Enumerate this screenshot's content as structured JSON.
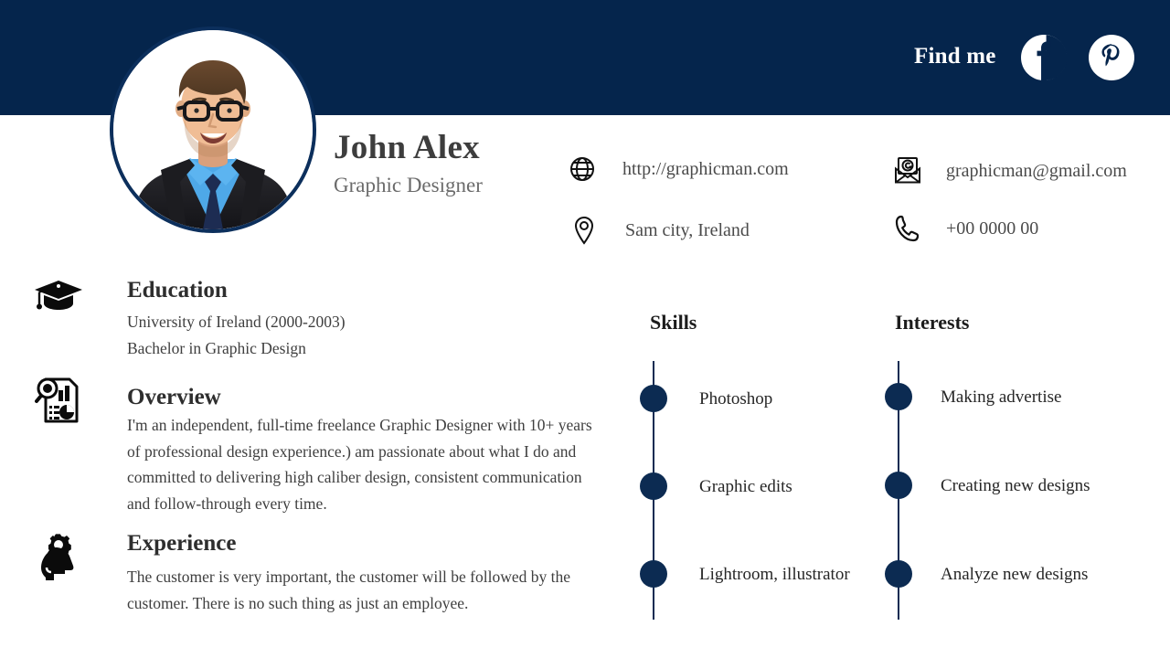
{
  "header": {
    "find_me_label": "Find me",
    "background_color": "#05254C",
    "social": [
      {
        "name": "facebook-icon",
        "label": "Facebook"
      },
      {
        "name": "pinterest-icon",
        "label": "Pinterest"
      }
    ]
  },
  "profile": {
    "name": "John Alex",
    "job_title": "Graphic Designer",
    "photo_alt": "Portrait of a smiling man with glasses wearing a dark suit, blue shirt and navy tie"
  },
  "contact": {
    "website": "http://graphicman.com",
    "email": "graphicman@gmail.com",
    "location": "Sam city, Ireland",
    "phone": "+00 0000 00"
  },
  "sections": {
    "education": {
      "title": "Education",
      "lines": [
        "University of Ireland (2000-2003)",
        "Bachelor in Graphic Design"
      ]
    },
    "overview": {
      "title": "Overview",
      "body": "I'm an independent, full-time freelance Graphic Designer with 10+ years of professional design experience.) am passionate about what I do and committed to delivering high caliber design, consistent communication and follow-through every time."
    },
    "experience": {
      "title": "Experience",
      "body": "The customer is very important, the customer will be followed by the customer. There is no such thing as just an employee."
    }
  },
  "skills": {
    "heading": "Skills",
    "items": [
      {
        "label": "Photoshop"
      },
      {
        "label": "Graphic edits"
      },
      {
        "label": "Lightroom, illustrator"
      }
    ]
  },
  "interests": {
    "heading": "Interests",
    "items": [
      {
        "label": "Making advertise"
      },
      {
        "label": "Creating new designs"
      },
      {
        "label": "Analyze new designs"
      }
    ]
  },
  "theme": {
    "navy": "#05254C",
    "dot_navy": "#0C2B52",
    "text_dark": "#2E2E2E",
    "text_body": "#3F3F3F",
    "text_muted": "#6B6B6B"
  }
}
